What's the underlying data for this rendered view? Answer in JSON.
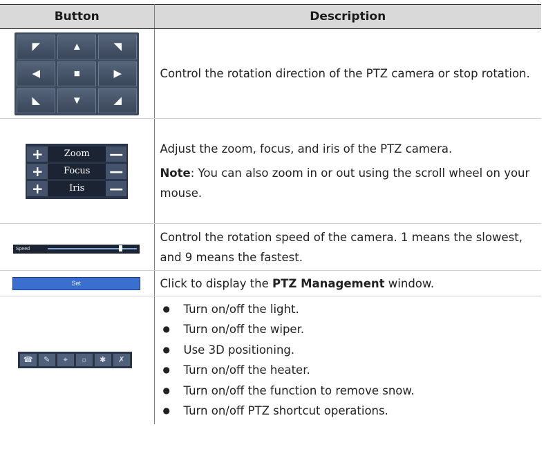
{
  "headers": {
    "button": "Button",
    "description": "Description"
  },
  "rows": {
    "direction": {
      "arrows": [
        "◤",
        "▲",
        "◥",
        "◀",
        "■",
        "▶",
        "◣",
        "▼",
        "◢"
      ],
      "text": "Control the rotation direction of the PTZ camera or stop rotation."
    },
    "zfi": {
      "labels": [
        "Zoom",
        "Focus",
        "Iris"
      ],
      "plus": "+",
      "minus": "—",
      "text": "Adjust the zoom, focus, and iris of the PTZ camera.",
      "note_label": "Note",
      "note_text": ": You can also zoom in or out using the scroll wheel on your mouse."
    },
    "speed": {
      "label": "Speed",
      "level_fraction": 0.8,
      "text": "Control the rotation speed of the camera. 1 means the slowest, and 9 means the fastest."
    },
    "set": {
      "button_label": "Set",
      "text_pre": "Click to display the ",
      "text_bold": "PTZ Management",
      "text_post": " window."
    },
    "toolbar": {
      "icons": [
        "light-icon",
        "wiper-icon",
        "3d-positioning-icon",
        "heater-icon",
        "snow-removal-icon",
        "shortcut-icon"
      ],
      "glyphs": [
        "☎",
        "✎",
        "⌖",
        "☼",
        "✱",
        "✗"
      ],
      "items": [
        "Turn on/off the light.",
        "Turn on/off the wiper.",
        "Use 3D positioning.",
        "Turn on/off the heater.",
        "Turn on/off the function to remove snow.",
        "Turn on/off PTZ shortcut operations."
      ]
    }
  }
}
